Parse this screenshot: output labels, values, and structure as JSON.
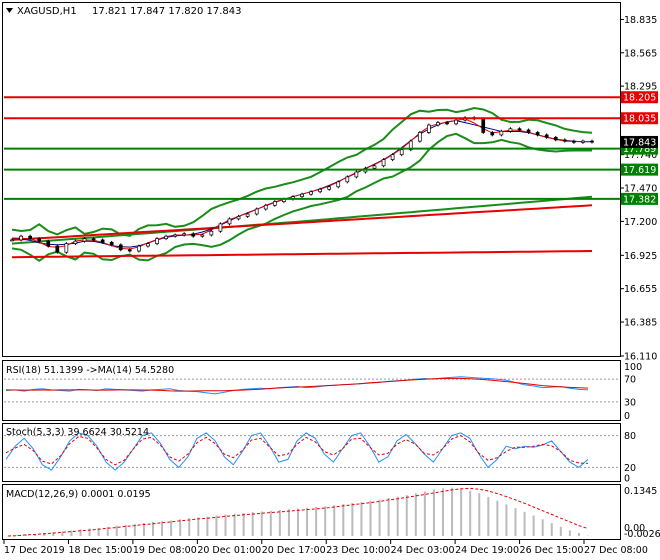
{
  "header": {
    "symbol_timeframe": "XAGUSD,H1",
    "ohlc": "17.821 17.847 17.820 17.843"
  },
  "price_scale": {
    "ticks": [
      "18.835",
      "18.565",
      "18.295",
      "17.740",
      "17.470",
      "17.200",
      "16.925",
      "16.655",
      "16.385",
      "16.110"
    ],
    "ylim": [
      16.11,
      18.96
    ]
  },
  "levels": [
    {
      "value": 18.205,
      "label": "18.205",
      "color": "#e60000"
    },
    {
      "value": 18.035,
      "label": "18.035",
      "color": "#e60000"
    },
    {
      "value": 17.789,
      "label": "17.789",
      "color": "#008000"
    },
    {
      "value": 17.619,
      "label": "17.619",
      "color": "#008000"
    },
    {
      "value": 17.382,
      "label": "17.382",
      "color": "#008000"
    }
  ],
  "current_price": {
    "value": 17.843,
    "label": "17.843"
  },
  "time_axis": [
    "17 Dec 2019",
    "18 Dec 15:00",
    "19 Dec 08:00",
    "20 Dec 01:00",
    "20 Dec 17:00",
    "23 Dec 10:00",
    "24 Dec 03:00",
    "24 Dec 19:00",
    "26 Dec 15:00",
    "27 Dec 08:00"
  ],
  "rsi": {
    "title": "RSI(18) 51.1399  ->MA(14) 54.5280",
    "ticks": [
      "100",
      "70",
      "30",
      "0"
    ],
    "series": [
      50,
      51,
      49,
      52,
      53,
      51,
      50,
      49,
      52,
      51,
      50,
      53,
      52,
      51,
      50,
      49,
      51,
      52,
      53,
      50,
      49,
      48,
      46,
      44,
      47,
      50,
      52,
      53,
      54,
      53,
      55,
      56,
      57,
      55,
      56,
      58,
      59,
      60,
      61,
      62,
      63,
      64,
      66,
      67,
      68,
      70,
      71,
      70,
      72,
      73,
      74,
      73,
      72,
      71,
      70,
      68,
      64,
      60,
      58,
      55,
      56,
      57,
      54,
      52,
      51
    ]
  },
  "stoch": {
    "title": "Stoch(5,3,3) 39.6624 30.5214",
    "ticks": [
      "80",
      "20",
      "0"
    ],
    "series": [
      35,
      60,
      75,
      55,
      25,
      15,
      40,
      70,
      85,
      80,
      60,
      30,
      15,
      30,
      55,
      80,
      85,
      65,
      35,
      20,
      40,
      75,
      85,
      70,
      40,
      25,
      50,
      80,
      85,
      60,
      30,
      35,
      70,
      85,
      75,
      45,
      30,
      55,
      80,
      85,
      60,
      30,
      40,
      70,
      82,
      65,
      45,
      30,
      55,
      80,
      85,
      75,
      45,
      20,
      35,
      60,
      55,
      60,
      58,
      62,
      70,
      50,
      30,
      20,
      35
    ]
  },
  "macd": {
    "title": "MACD(12,26,9) 0.0001 0.0195",
    "ticks": [
      "0.1345",
      "0.00",
      "-0.0026"
    ],
    "histogram": [
      0.0,
      0.002,
      0.004,
      0.006,
      0.008,
      0.01,
      0.012,
      0.015,
      0.018,
      0.02,
      0.022,
      0.025,
      0.028,
      0.03,
      0.032,
      0.035,
      0.038,
      0.04,
      0.042,
      0.045,
      0.048,
      0.05,
      0.052,
      0.055,
      0.058,
      0.06,
      0.062,
      0.064,
      0.066,
      0.068,
      0.07,
      0.072,
      0.074,
      0.076,
      0.078,
      0.08,
      0.083,
      0.086,
      0.089,
      0.092,
      0.095,
      0.098,
      0.102,
      0.106,
      0.11,
      0.115,
      0.12,
      0.125,
      0.128,
      0.13,
      0.127,
      0.122,
      0.115,
      0.105,
      0.095,
      0.085,
      0.075,
      0.065,
      0.055,
      0.045,
      0.035,
      0.025,
      0.015,
      0.008,
      0.001
    ],
    "signal": [
      0.0,
      0.001,
      0.003,
      0.004,
      0.006,
      0.008,
      0.01,
      0.012,
      0.014,
      0.016,
      0.018,
      0.021,
      0.023,
      0.026,
      0.028,
      0.031,
      0.033,
      0.036,
      0.038,
      0.041,
      0.043,
      0.046,
      0.048,
      0.05,
      0.053,
      0.055,
      0.057,
      0.059,
      0.061,
      0.063,
      0.065,
      0.067,
      0.069,
      0.071,
      0.073,
      0.075,
      0.078,
      0.081,
      0.084,
      0.087,
      0.09,
      0.093,
      0.097,
      0.1,
      0.104,
      0.108,
      0.112,
      0.116,
      0.12,
      0.124,
      0.127,
      0.128,
      0.126,
      0.121,
      0.114,
      0.106,
      0.097,
      0.088,
      0.078,
      0.068,
      0.058,
      0.048,
      0.038,
      0.028,
      0.02
    ],
    "ylim": [
      -0.0026,
      0.1345
    ]
  },
  "chart_data": {
    "type": "line",
    "title": "XAGUSD,H1",
    "x": [
      "17 Dec 2019",
      "18 Dec 15:00",
      "19 Dec 08:00",
      "20 Dec 01:00",
      "20 Dec 17:00",
      "23 Dec 10:00",
      "24 Dec 03:00",
      "24 Dec 19:00",
      "26 Dec 15:00",
      "27 Dec 08:00"
    ],
    "ylim": [
      16.11,
      18.96
    ],
    "series": [
      {
        "values": [
          17.05,
          17.08,
          17.06,
          17.04,
          17.0,
          16.95,
          17.02,
          17.04,
          17.06,
          17.05,
          17.03,
          17.01,
          16.97,
          16.96,
          17.0,
          17.02,
          17.06,
          17.08,
          17.09,
          17.1,
          17.08,
          17.09,
          17.12,
          17.18,
          17.22,
          17.24,
          17.26,
          17.3,
          17.33,
          17.36,
          17.38,
          17.4,
          17.42,
          17.44,
          17.46,
          17.48,
          17.52,
          17.56,
          17.6,
          17.63,
          17.65,
          17.7,
          17.74,
          17.78,
          17.85,
          17.92,
          17.98,
          18.0,
          17.99,
          18.02,
          18.04,
          18.03,
          17.92,
          17.9,
          17.93,
          17.95,
          17.94,
          17.92,
          17.9,
          17.88,
          17.86,
          17.85,
          17.84,
          17.85,
          17.843
        ]
      }
    ]
  },
  "colors": {
    "red": "#e60000",
    "green": "#008000",
    "blue": "#1e90ff",
    "darkgreen": "#1a8c1a",
    "navy": "#00008b",
    "label_text": "#ffffff"
  }
}
